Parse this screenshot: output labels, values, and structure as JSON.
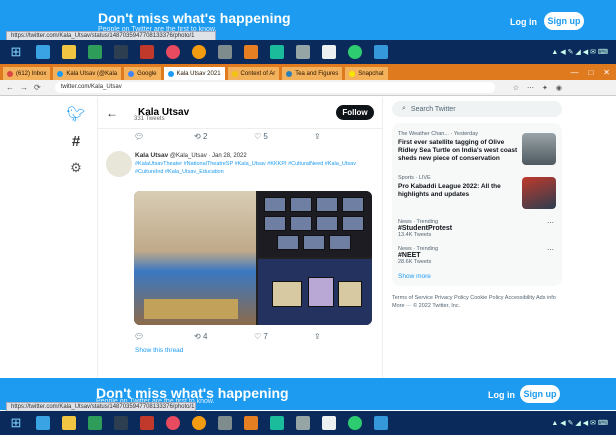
{
  "banner": {
    "title": "Don't miss what's happening",
    "subtitle": "People on Twitter are the first to know.",
    "login_label": "Log in",
    "signup_label": "Sign up",
    "status_url": "https://twitter.com/Kala_Utsav/status/1487035947708133376/photo/1"
  },
  "browser": {
    "tabs": [
      {
        "label": "(612) Inbox",
        "active": false
      },
      {
        "label": "Kala Utsav (@Kala",
        "active": false
      },
      {
        "label": "Google",
        "active": false
      },
      {
        "label": "Kala Utsav 2021",
        "active": true
      },
      {
        "label": "Context of Ar",
        "active": false
      },
      {
        "label": "Tea and Figures",
        "active": false
      },
      {
        "label": "Snapchat",
        "active": false
      }
    ],
    "window_controls": [
      "—",
      "□",
      "✕"
    ],
    "url": "twitter.com/Kala_Utsav"
  },
  "colors": {
    "twitter_blue": "#1d9bf0",
    "tab_orange": "#e07a1f",
    "taskbar": "#0a2a5c"
  },
  "nav": {
    "icons": [
      "twitter-bird-icon",
      "explore-hash-icon",
      "settings-gear-icon"
    ]
  },
  "profile": {
    "name": "Kala Utsav",
    "tweets": "331 Tweets",
    "follow_label": "Follow"
  },
  "tweet": {
    "author": "Kala Utsav",
    "handle_date": "@Kala_Utsav · Jan 28, 2022",
    "hashtags": "#KalaUtsavTheater #NationalTheatreSP #Kala_Utsav #KKKPI #CulturalNeed #Kala_Utsav #CultureInd #Kala_Utsav_Education",
    "top_actions": {
      "reply": "",
      "retweet": "2",
      "like": "5"
    },
    "actions": {
      "reply": "",
      "retweet": "4",
      "like": "7"
    },
    "show_thread": "Show this thread"
  },
  "sidebar": {
    "search_placeholder": "Search Twitter",
    "news": [
      {
        "source": "The Weather Chan... · Yesterday",
        "headline": "First ever satellite tagging of Olive Ridley Sea Turtle on India's west coast sheds new piece of conservation"
      },
      {
        "source": "Sports · LIVE",
        "headline": "Pro Kabaddi League 2022: All the highlights and updates"
      }
    ],
    "trends": [
      {
        "context": "News · Trending",
        "name": "#StudentProtest",
        "count": "13.4K Tweets"
      },
      {
        "context": "News · Trending",
        "name": "#NEET",
        "count": "28.6K Tweets"
      }
    ],
    "show_more": "Show more",
    "footer": "Terms of Service  Privacy Policy  Cookie Policy  Accessibility  Ads info  More ···  © 2022 Twitter, Inc."
  },
  "taskbar": {
    "tray": "▲ ◀ ✎ ◢ ◀ ✉ ⌨"
  }
}
